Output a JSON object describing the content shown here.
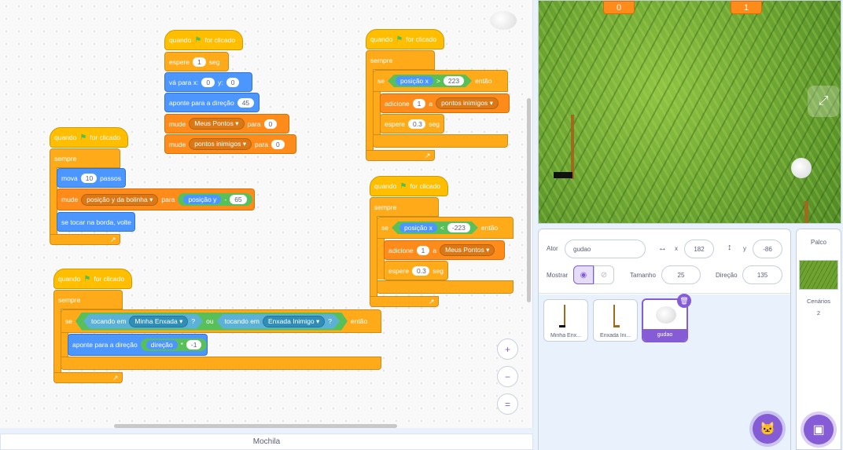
{
  "code": {
    "script1": {
      "hat": "quando",
      "hat_suffix": "for clicado",
      "wait_label": "espere",
      "wait_value": "1",
      "wait_unit": "seg",
      "goto_label": "vá para x:",
      "goto_x": "0",
      "goto_y_label": "y:",
      "goto_y": "0",
      "point_label": "aponte para a direção",
      "point_value": "45",
      "set1_label": "mude",
      "set1_var": "Meus Pontos",
      "set1_to": "para",
      "set1_value": "0",
      "set2_label": "mude",
      "set2_var": "pontos inimigos",
      "set2_to": "para",
      "set2_value": "0"
    },
    "script2": {
      "hat": "quando",
      "hat_suffix": "for clicado",
      "forever": "sempre",
      "move_label": "mova",
      "move_value": "10",
      "move_unit": "passos",
      "set_label": "mude",
      "set_var": "posição y da bolinha",
      "set_to": "para",
      "set_reporter": "posição y",
      "set_op": "-",
      "set_value": "65",
      "bounce": "se tocar na borda, volte"
    },
    "script3": {
      "hat": "quando",
      "hat_suffix": "for clicado",
      "forever": "sempre",
      "if": "se",
      "touch1": "tocando em",
      "touch1_target": "Minha Enxada",
      "q1": "?",
      "or": "ou",
      "touch2": "tocando em",
      "touch2_target": "Enxada Inimigo",
      "q2": "?",
      "then": "então",
      "point_label": "aponte para a direção",
      "point_reporter": "direção",
      "point_op": "*",
      "point_value": "-1"
    },
    "script4": {
      "hat": "quando",
      "hat_suffix": "for clicado",
      "forever": "sempre",
      "if": "se",
      "reporter": "posição x",
      "op": ">",
      "value": "223",
      "then": "então",
      "add_label": "adicione",
      "add_value": "1",
      "add_a": "a",
      "add_var": "pontos inimigos",
      "wait_label": "espere",
      "wait_value": "0.3",
      "wait_unit": "seg"
    },
    "script5": {
      "hat": "quando",
      "hat_suffix": "for clicado",
      "forever": "sempre",
      "if": "se",
      "reporter": "posição x",
      "op": "<",
      "value": "-223",
      "then": "então",
      "add_label": "adicione",
      "add_value": "1",
      "add_a": "a",
      "add_var": "Meus Pontos",
      "wait_label": "espere",
      "wait_value": "0.3",
      "wait_unit": "seg"
    },
    "zoom_in": "+",
    "zoom_out": "−",
    "zoom_reset": "="
  },
  "backpack": "Mochila",
  "stage": {
    "score_left": "0",
    "score_right": "1"
  },
  "sprite": {
    "ator_label": "Ator",
    "ator_value": "gudao",
    "x_label": "x",
    "x_value": "182",
    "y_label": "y",
    "y_value": "-86",
    "show_label": "Mostrar",
    "size_label": "Tamanho",
    "size_value": "25",
    "direction_label": "Direção",
    "direction_value": "135",
    "tiles": [
      "Minha Enx...",
      "Enxada Ini...",
      "gudao"
    ]
  },
  "stage_panel": {
    "title": "Palco",
    "backdrops_label": "Cenários",
    "backdrops_count": "2"
  },
  "colors": {
    "events": "#ffbf00",
    "control": "#ffab19",
    "motion": "#4c97ff",
    "variables": "#ff8c1a",
    "sensing": "#5cb1d6",
    "operators": "#59c059",
    "accent": "#855cd6"
  }
}
